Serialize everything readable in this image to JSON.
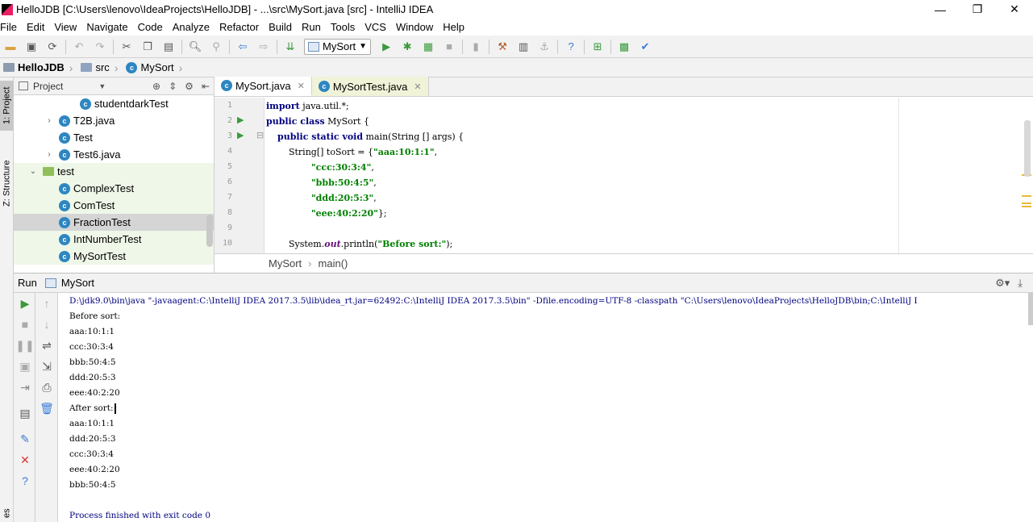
{
  "window": {
    "title": "HelloJDB [C:\\Users\\lenovo\\IdeaProjects\\HelloJDB] - ...\\src\\MySort.java [src] - IntelliJ IDEA",
    "controls": [
      "—",
      "❐",
      "✕"
    ]
  },
  "menu": [
    "File",
    "Edit",
    "View",
    "Navigate",
    "Code",
    "Analyze",
    "Refactor",
    "Build",
    "Run",
    "Tools",
    "VCS",
    "Window",
    "Help"
  ],
  "toolbar": {
    "run_config": "MySort"
  },
  "navbar": {
    "project": "HelloJDB",
    "folder": "src",
    "file": "MySort"
  },
  "left_strip": {
    "project_tab": "1: Project",
    "structure_tab": "Z: Structure",
    "bottom_tab": "es"
  },
  "project_panel": {
    "header": "Project",
    "tree": [
      {
        "label": "studentdarkTest",
        "indent": 2,
        "type": "class",
        "arrow": "",
        "style": ""
      },
      {
        "label": "T2B.java",
        "indent": 1,
        "type": "class",
        "arrow": "›",
        "style": ""
      },
      {
        "label": "Test",
        "indent": 1,
        "type": "class",
        "arrow": "",
        "style": ""
      },
      {
        "label": "Test6.java",
        "indent": 1,
        "type": "class",
        "arrow": "›",
        "style": ""
      },
      {
        "label": "test",
        "indent": 0,
        "type": "folder",
        "arrow": "⌄",
        "style": "green"
      },
      {
        "label": "ComplexTest",
        "indent": 1,
        "type": "class",
        "arrow": "",
        "style": "green"
      },
      {
        "label": "ComTest",
        "indent": 1,
        "type": "class",
        "arrow": "",
        "style": "green"
      },
      {
        "label": "FractionTest",
        "indent": 1,
        "type": "class",
        "arrow": "",
        "style": "sel"
      },
      {
        "label": "IntNumberTest",
        "indent": 1,
        "type": "class",
        "arrow": "",
        "style": "green"
      },
      {
        "label": "MySortTest",
        "indent": 1,
        "type": "class",
        "arrow": "",
        "style": "green"
      }
    ]
  },
  "editor": {
    "tabs": [
      {
        "label": "MySort.java",
        "active": true
      },
      {
        "label": "MySortTest.java",
        "active": false
      }
    ],
    "lines": [
      {
        "n": "1",
        "html": "<span class=\"kw\">import</span> java.util.*;"
      },
      {
        "n": "2",
        "html": "<span class=\"kw\">public class</span> MySort {"
      },
      {
        "n": "3",
        "html": "    <span class=\"kw\">public static void</span> main(String [] args) {"
      },
      {
        "n": "4",
        "html": "        String[] toSort = {<span class=\"str\">\"aaa:10:1:1\"</span>,"
      },
      {
        "n": "5",
        "html": "                <span class=\"str\">\"ccc:30:3:4\"</span>,"
      },
      {
        "n": "6",
        "html": "                <span class=\"str\">\"bbb:50:4:5\"</span>,"
      },
      {
        "n": "7",
        "html": "                <span class=\"str\">\"ddd:20:5:3\"</span>,"
      },
      {
        "n": "8",
        "html": "                <span class=\"str\">\"eee:40:2:20\"</span>};"
      },
      {
        "n": "9",
        "html": ""
      },
      {
        "n": "10",
        "html": "        System.<span class=\"fld\">out</span>.println(<span class=\"str\">\"Before sort:\"</span>);"
      }
    ],
    "breadcrumb": [
      "MySort",
      "main()"
    ]
  },
  "run_panel": {
    "label": "Run",
    "config": "MySort",
    "console": [
      "D:\\jdk9.0\\bin\\java \"-javaagent:C:\\IntelliJ IDEA 2017.3.5\\lib\\idea_rt.jar=62492:C:\\IntelliJ IDEA 2017.3.5\\bin\" -Dfile.encoding=UTF-8 -classpath \"C:\\Users\\lenovo\\IdeaProjects\\HelloJDB\\bin;C:\\IntelliJ I",
      "Before sort:",
      "aaa:10:1:1",
      "ccc:30:3:4",
      "bbb:50:4:5",
      "ddd:20:5:3",
      "eee:40:2:20",
      "After sort:",
      "aaa:10:1:1",
      "ddd:20:5:3",
      "ccc:30:3:4",
      "eee:40:2:20",
      "bbb:50:4:5",
      "",
      "Process finished with exit code 0"
    ]
  }
}
